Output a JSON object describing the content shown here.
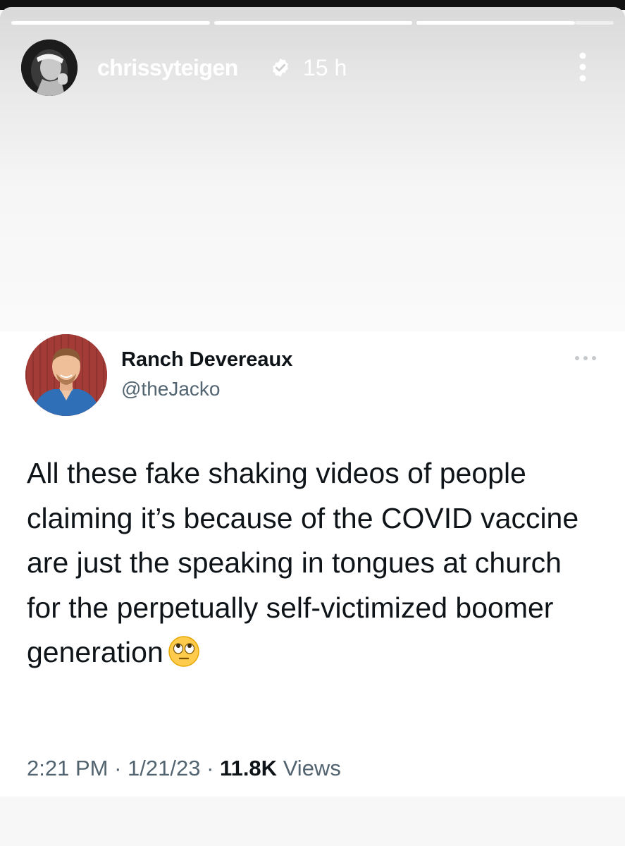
{
  "story": {
    "username": "chrissyteigen",
    "time_ago": "15 h",
    "segments_total": 3,
    "active_segment_progress": 0.8,
    "icons": [
      "verified-badge-icon",
      "more-vertical-icon"
    ]
  },
  "tweet": {
    "display_name": "Ranch Devereaux",
    "handle": "@theJacko",
    "text": "All these fake shaking videos of people claiming it’s because of the COVID vaccine are just the speaking in tongues at church for the perpetually self-victimized boomer generation",
    "emoji": "face-with-rolling-eyes",
    "time": "2:21 PM",
    "separator": "·",
    "date": "1/21/23",
    "views_count": "11.8K",
    "views_label": "Views",
    "icons": [
      "more-horizontal-icon"
    ]
  },
  "colors": {
    "text_primary": "#0f1419",
    "text_secondary": "#536471",
    "story_overlay_text": "#ffffff",
    "tweet_bg": "#ffffff"
  }
}
